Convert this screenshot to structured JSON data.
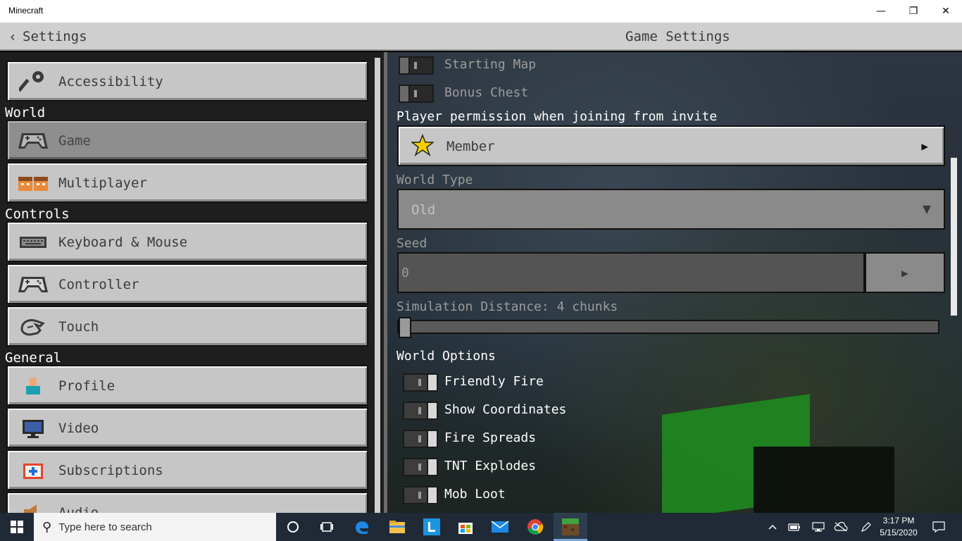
{
  "window": {
    "title": "Minecraft",
    "minimize": "—",
    "restore": "❐",
    "close": "✕"
  },
  "header": {
    "back_chevron": "‹",
    "back_label": "Settings",
    "page_title": "Game Settings"
  },
  "sidebar": {
    "sections": [
      "World",
      "Controls",
      "General"
    ],
    "items": [
      {
        "label": "Accessibility",
        "icon": "key-icon"
      },
      {
        "label": "Game",
        "icon": "gamepad-icon",
        "selected": true
      },
      {
        "label": "Multiplayer",
        "icon": "players-icon"
      },
      {
        "label": "Keyboard & Mouse",
        "icon": "keyboard-icon"
      },
      {
        "label": "Controller",
        "icon": "controller-icon"
      },
      {
        "label": "Touch",
        "icon": "touch-icon"
      },
      {
        "label": "Profile",
        "icon": "profile-icon"
      },
      {
        "label": "Video",
        "icon": "monitor-icon"
      },
      {
        "label": "Subscriptions",
        "icon": "subscriptions-icon"
      },
      {
        "label": "Audio",
        "icon": "speaker-icon"
      }
    ]
  },
  "game": {
    "starting_map": {
      "label": "Starting Map",
      "on": false,
      "enabled": false
    },
    "bonus_chest": {
      "label": "Bonus Chest",
      "on": false,
      "enabled": false
    },
    "player_permission": {
      "heading": "Player permission when joining from invite",
      "value": "Member",
      "icon": "star-icon",
      "arrow": "▶"
    },
    "world_type": {
      "heading": "World Type",
      "value": "Old",
      "arrow": "▼"
    },
    "seed": {
      "heading": "Seed",
      "value": "0",
      "button_arrow": "▶"
    },
    "simulation_distance": {
      "label": "Simulation Distance: 4 chunks",
      "chunks": 4,
      "fraction": 0.0
    },
    "world_options_heading": "World Options",
    "world_options": [
      {
        "label": "Friendly Fire",
        "on": true
      },
      {
        "label": "Show Coordinates",
        "on": true
      },
      {
        "label": "Fire Spreads",
        "on": true
      },
      {
        "label": "TNT Explodes",
        "on": true
      },
      {
        "label": "Mob Loot",
        "on": true
      }
    ]
  },
  "taskbar": {
    "search_placeholder": "Type here to search",
    "apps": [
      "cortana-icon",
      "task-view-icon",
      "edge-icon",
      "file-explorer-icon",
      "l-app-icon",
      "store-icon",
      "mail-icon",
      "chrome-icon",
      "minecraft-icon"
    ],
    "tray": [
      "chevron-up-icon",
      "battery-icon",
      "network-icon",
      "onedrive-icon",
      "pen-icon",
      "notification-icon"
    ],
    "time": "3:17 PM",
    "date": "5/15/2020",
    "colors": {
      "taskbar_bg": "#1f2a36",
      "active_app_underline": "#7aa7d8"
    }
  }
}
